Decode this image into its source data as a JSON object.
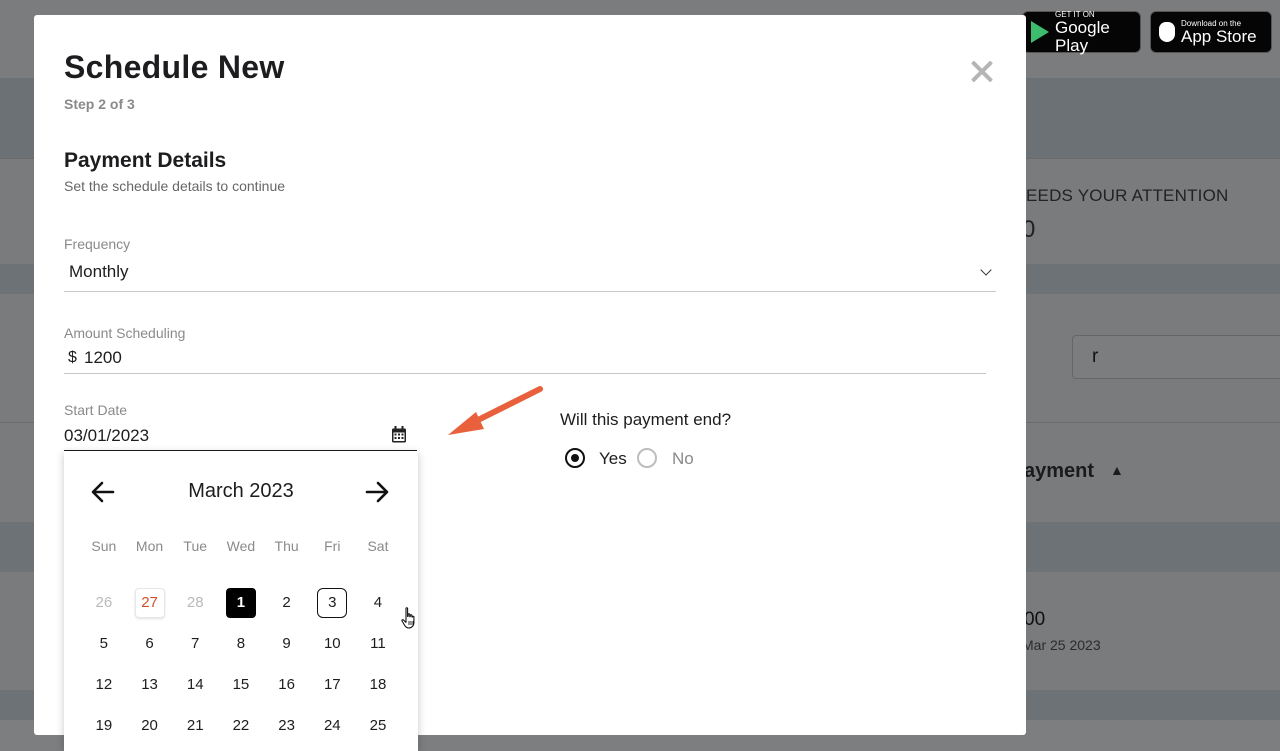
{
  "background": {
    "badges": {
      "google_small": "GET IT ON",
      "google_big": "Google Play",
      "apple_small": "Download on the",
      "apple_big": "App Store"
    },
    "attention_label": "EEDS YOUR ATTENTION",
    "attention_count": "0",
    "search_value": "r",
    "payment_header": "ayment",
    "row_amount": "00",
    "row_date": "Mar 25 2023"
  },
  "modal": {
    "title": "Schedule New",
    "step": "Step 2 of 3",
    "section_title": "Payment Details",
    "section_subtitle": "Set the schedule details to continue",
    "frequency": {
      "label": "Frequency",
      "value": "Monthly"
    },
    "amount": {
      "label": "Amount Scheduling",
      "currency": "$",
      "value": "1200"
    },
    "start_date": {
      "label": "Start Date",
      "value": "03/01/2023"
    },
    "end_question": "Will this payment end?",
    "end_options": {
      "yes": "Yes",
      "no": "No",
      "selected": "Yes"
    }
  },
  "calendar": {
    "month_label": "March 2023",
    "weekdays": [
      "Sun",
      "Mon",
      "Tue",
      "Wed",
      "Thu",
      "Fri",
      "Sat"
    ],
    "weeks": [
      [
        "26",
        "27",
        "28",
        "1",
        "2",
        "3",
        "4"
      ],
      [
        "5",
        "6",
        "7",
        "8",
        "9",
        "10",
        "11"
      ],
      [
        "12",
        "13",
        "14",
        "15",
        "16",
        "17",
        "18"
      ],
      [
        "19",
        "20",
        "21",
        "22",
        "23",
        "24",
        "25"
      ]
    ],
    "selected_day": "1",
    "today": "27",
    "focused_day": "3"
  },
  "colors": {
    "annotation_arrow": "#e8613c",
    "today_text": "#d2502a",
    "overlay": "#7d7e80"
  },
  "icons": [
    "close-icon",
    "chevron-down-icon",
    "calendar-icon",
    "arrow-left-icon",
    "arrow-right-icon",
    "hand-cursor-icon"
  ]
}
